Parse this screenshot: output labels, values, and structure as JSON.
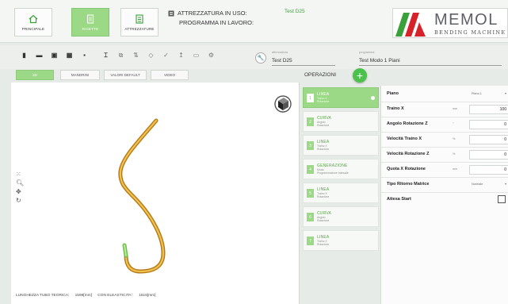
{
  "nav": {
    "buttons": [
      {
        "label": "PRINCIPALE",
        "icon": "home-icon",
        "active": false
      },
      {
        "label": "RICETTE",
        "icon": "recipe-icon",
        "active": true
      },
      {
        "label": "ATTREZZATURE",
        "icon": "tooling-icon",
        "active": false
      }
    ]
  },
  "header": {
    "tooling_label": "ATTREZZATURA IN USO:",
    "tooling_value": "Test D25",
    "program_label": "PROGRAMMA IN LAVORO:",
    "program_value": ""
  },
  "logo": {
    "name": "MEMOL",
    "tagline": "BENDING MACHINE",
    "colors": {
      "green": "#3aa13a",
      "red": "#d6232a",
      "grey": "#5d6064"
    }
  },
  "toolbar": {
    "tooling_field_label": "attrezzatura",
    "tooling_field_value": "Test D25",
    "program_field_label": "programma",
    "program_field_value": "Test Modo 1 Piani"
  },
  "subtabs": [
    "3D",
    "MANDRINI",
    "VALORI DEFAULT",
    "VIDEO"
  ],
  "operations": {
    "title": "OPERAZIONI",
    "add_label": "+",
    "items": [
      {
        "num": "1",
        "name": "LINEA",
        "sub": "Traino X\nRotazione",
        "active": true
      },
      {
        "num": "2",
        "name": "CURVA",
        "sub": "Angolo\nRotazione",
        "active": false
      },
      {
        "num": "3",
        "name": "LINEA",
        "sub": "Traino X\nRotazione",
        "active": false
      },
      {
        "num": "4",
        "name": "GENERAZIONE",
        "sub": "Modo\nProgrammazione manuale",
        "active": false
      },
      {
        "num": "5",
        "name": "LINEA",
        "sub": "Traino X\nRotazione",
        "active": false
      },
      {
        "num": "6",
        "name": "CURVA",
        "sub": "Angolo\nRotazione",
        "active": false
      },
      {
        "num": "7",
        "name": "LINEA",
        "sub": "Traino X\nRotazione",
        "active": false
      }
    ]
  },
  "params": [
    {
      "label": "Piano",
      "unit": "",
      "value": "Piano 1",
      "type": "select"
    },
    {
      "label": "Traino X",
      "unit": "mm",
      "value": "100",
      "type": "number"
    },
    {
      "label": "Angolo Rotazione Z",
      "unit": "°",
      "value": "0",
      "type": "number"
    },
    {
      "label": "Velocità Traino X",
      "unit": "%",
      "value": "0",
      "type": "number"
    },
    {
      "label": "Velocità Rotazione Z",
      "unit": "%",
      "value": "0",
      "type": "number"
    },
    {
      "label": "Quota X Rotazione",
      "unit": "mm",
      "value": "0",
      "type": "number"
    },
    {
      "label": "Tipo Ritorno Matrice",
      "unit": "",
      "value": "Normale",
      "type": "select"
    },
    {
      "label": "Attesa Start",
      "unit": "",
      "value": "",
      "type": "checkbox"
    }
  ],
  "footer": {
    "length_label": "LUNGHEZZA TUBO TEORICA:",
    "length_value": "1599[mm]",
    "elastic_label": "CON ELEASTICITA':",
    "elastic_value": "1616[mm]"
  },
  "colors": {
    "accent": "#9cd987",
    "add_button": "#4cc14c",
    "tube": "#e0a32a",
    "tube_end": "#8fd16a"
  }
}
